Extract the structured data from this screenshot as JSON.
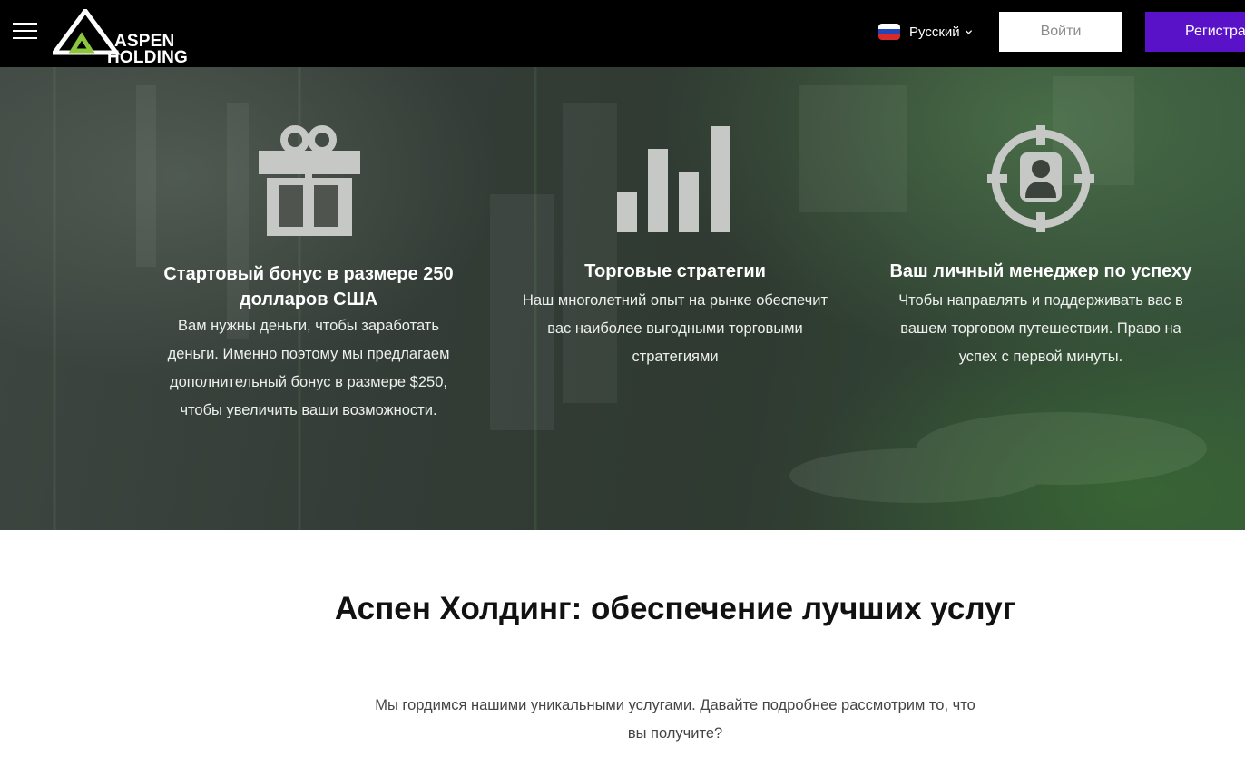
{
  "header": {
    "logo_line1": "ASPEN",
    "logo_line2": "HOLDING",
    "language": "Русский",
    "login_label": "Войти",
    "register_label": "Регистрация"
  },
  "features": [
    {
      "icon": "gift-icon",
      "title": "Стартовый бонус в размере 250 долларов США",
      "text": "Вам нужны деньги, чтобы заработать деньги. Именно поэтому мы предлагаем дополнительный бонус в размере $250, чтобы увеличить ваши возможности."
    },
    {
      "icon": "bar-chart-icon",
      "title": "Торговые стратегии",
      "text": "Наш многолетний опыт на рынке обеспечит вас наиболее выгодными торговыми стратегиями"
    },
    {
      "icon": "manager-target-icon",
      "title": "Ваш личный менеджер по успеху",
      "text": "Чтобы направлять и поддерживать вас в вашем торговом путешествии. Право на успех с первой минуты."
    }
  ],
  "section": {
    "title": "Аспен Холдинг: обеспечение лучших услуг",
    "subtitle": "Мы гордимся нашими уникальными услугами. Давайте подробнее рассмотрим то, что вы получите?"
  },
  "colors": {
    "header_bg": "#000000",
    "accent_purple": "#5a12c8",
    "logo_green": "#8cc63f",
    "icon_gray": "#c5c8c4"
  }
}
